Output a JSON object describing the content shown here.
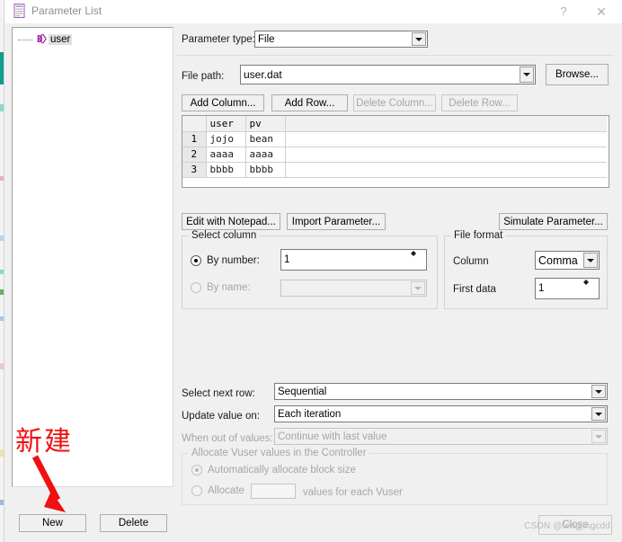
{
  "window": {
    "title": "Parameter List",
    "title_icon": "parameter-list-icon",
    "help_label": "?",
    "close_label": "✕"
  },
  "tree": {
    "items": [
      {
        "label": "user",
        "icon": "parameter-icon",
        "selected": true
      }
    ]
  },
  "annotation": {
    "text": "新建",
    "color": "#f01010",
    "points_to": "New"
  },
  "left_buttons": {
    "new_label": "New",
    "delete_label": "Delete"
  },
  "parameter_type": {
    "label": "Parameter type:",
    "value": "File"
  },
  "file_path": {
    "label": "File path:",
    "value": "user.dat",
    "browse_label": "Browse..."
  },
  "table_toolbar": {
    "add_column": "Add Column...",
    "add_row": "Add Row...",
    "delete_column": "Delete Column...",
    "delete_row": "Delete Row..."
  },
  "table": {
    "columns": [
      "user",
      "pv"
    ],
    "rows": [
      {
        "num": "1",
        "cells": [
          "jojo",
          "bean"
        ]
      },
      {
        "num": "2",
        "cells": [
          "aaaa",
          "aaaa"
        ]
      },
      {
        "num": "3",
        "cells": [
          "bbbb",
          "bbbb"
        ]
      }
    ]
  },
  "table_actions": {
    "edit_with_notepad": "Edit with Notepad...",
    "import_parameter": "Import Parameter...",
    "simulate_parameter": "Simulate Parameter..."
  },
  "select_column": {
    "title": "Select column",
    "by_number_label": "By number:",
    "by_number_value": "1",
    "by_number_selected": true,
    "by_name_label": "By name:",
    "by_name_value": "",
    "by_name_selected": false
  },
  "file_format": {
    "title": "File format",
    "column_label": "Column",
    "column_value": "Comma",
    "first_data_label": "First data",
    "first_data_value": "1"
  },
  "row_options": {
    "select_next_row_label": "Select next row:",
    "select_next_row_value": "Sequential",
    "update_value_on_label": "Update value on:",
    "update_value_on_value": "Each iteration",
    "when_out_of_values_label": "When out of values:",
    "when_out_of_values_value": "Continue with last value"
  },
  "allocate": {
    "title": "Allocate Vuser values in the Controller",
    "auto_label": "Automatically allocate block size",
    "auto_selected": true,
    "allocate_label": "Allocate",
    "allocate_value": "",
    "allocate_suffix": "values for each Vuser"
  },
  "footer": {
    "close_label": "Close",
    "watermark": "CSDN @fengjingcdd"
  }
}
